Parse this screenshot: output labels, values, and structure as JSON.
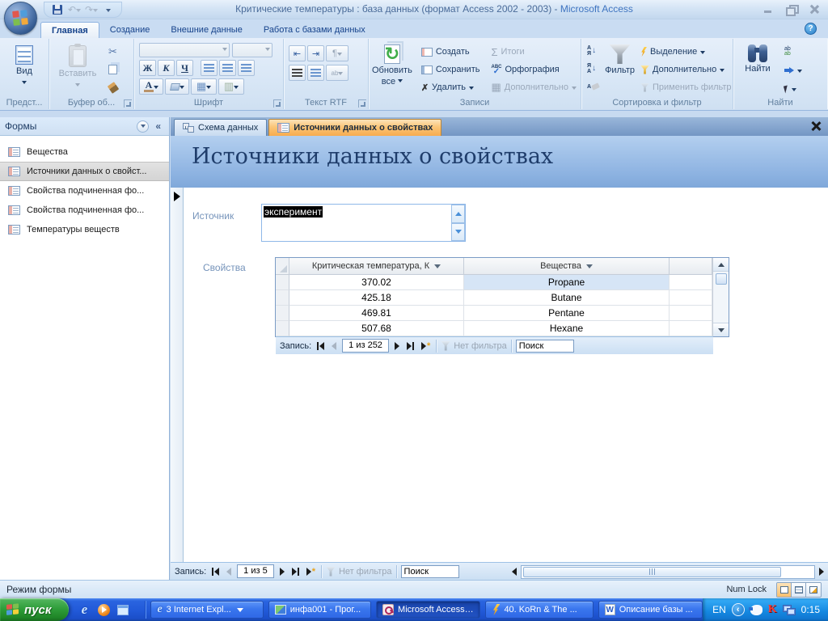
{
  "titlebar": {
    "db_title": "Критические температуры : база данных (формат Access 2002 - 2003)",
    "separator": " - ",
    "app_name": "Microsoft Access"
  },
  "help_glyph": "?",
  "ribbon_tabs": [
    {
      "label": "Главная"
    },
    {
      "label": "Создание"
    },
    {
      "label": "Внешние данные"
    },
    {
      "label": "Работа с базами данных"
    }
  ],
  "ribbon": {
    "views": {
      "label": "Предст...",
      "view": "Вид"
    },
    "clipboard": {
      "label": "Буфер об...",
      "paste": "Вставить"
    },
    "font": {
      "label": "Шрифт",
      "bold": "Ж",
      "italic": "К",
      "underline": "Ч",
      "font_color": "А"
    },
    "rtf": {
      "label": "Текст RTF"
    },
    "records": {
      "label": "Записи",
      "refresh_line1": "Обновить",
      "refresh_line2": "все",
      "create": "Создать",
      "save": "Сохранить",
      "delete": "Удалить",
      "totals": "Итоги",
      "spelling": "Орфография",
      "more": "Дополнительно"
    },
    "sort": {
      "label": "Сортировка и фильтр",
      "filter": "Фильтр",
      "selection": "Выделение",
      "advanced": "Дополнительно",
      "toggle": "Применить фильтр",
      "asc_letters_top": "А",
      "asc_letters_bottom": "Я",
      "desc_letters_top": "Я",
      "desc_letters_bottom": "А",
      "clear_letter": "А",
      "arrow": "↓"
    },
    "find": {
      "label": "Найти",
      "find": "Найти",
      "replace_hint": "ab"
    }
  },
  "icons": {
    "undo": "↶",
    "redo": "↷",
    "cut": "✂",
    "refresh": "↻",
    "sum": "Σ",
    "delete": "✗",
    "check": "✓",
    "paragraph": "¶",
    "grid1": "▦",
    "grid2": "▥",
    "indent_left": "⇤",
    "indent_right": "⇥",
    "collapse": "«",
    "new_star": "*",
    "spell_abc": "ABC",
    "word_w": "W",
    "kaspersky_k": "K",
    "ie_e": "e",
    "tray_chevron": "‹"
  },
  "sidebar": {
    "title": "Формы",
    "items": [
      {
        "label": "Вещества"
      },
      {
        "label": "Источники данных о свойст..."
      },
      {
        "label": "Свойства подчиненная фо..."
      },
      {
        "label": "Свойства подчиненная фо..."
      },
      {
        "label": "Температуры веществ"
      }
    ]
  },
  "doc_tabs": [
    {
      "label": "Схема данных"
    },
    {
      "label": "Источники данных о свойствах"
    }
  ],
  "form": {
    "title": "Источники данных о свойствах",
    "source_label": "Источник",
    "source_value": "эксперимент",
    "properties_label": "Свойства",
    "datasheet": {
      "columns": [
        {
          "label": "Критическая температура, К"
        },
        {
          "label": "Вещества"
        }
      ],
      "rows": [
        [
          "370.02",
          "Propane"
        ],
        [
          "425.18",
          "Butane"
        ],
        [
          "469.81",
          "Pentane"
        ],
        [
          "507.68",
          "Hexane"
        ]
      ]
    },
    "subform_nav": {
      "position": "1 из 252"
    },
    "main_nav": {
      "position": "1 из 5"
    }
  },
  "nav": {
    "record": "Запись:",
    "no_filter": "Нет фильтра",
    "search": "Поиск"
  },
  "status": {
    "mode": "Режим формы",
    "numlock": "Num Lock"
  },
  "taskbar": {
    "start": "пуск",
    "buttons": [
      {
        "label": "3 Internet Expl...",
        "icon": "ie",
        "has_caret": true
      },
      {
        "label": "инфа001 - Прог...",
        "icon": "image"
      },
      {
        "label": "Microsoft Access ...",
        "icon": "access",
        "active": true
      },
      {
        "label": "40. KoRn & The ...",
        "icon": "winamp"
      },
      {
        "label": "Описание базы ...",
        "icon": "word"
      }
    ],
    "tray": {
      "lang": "EN",
      "clock": "0:15"
    }
  },
  "colors": {
    "active_doc_tab": "#f7ab4e",
    "taskbar_blue": "#2a64e0",
    "start_green": "#2f9e3a",
    "form_header_blue": "#8fb4e2",
    "selection_bg": "#000000",
    "selection_fg": "#ffffff"
  }
}
